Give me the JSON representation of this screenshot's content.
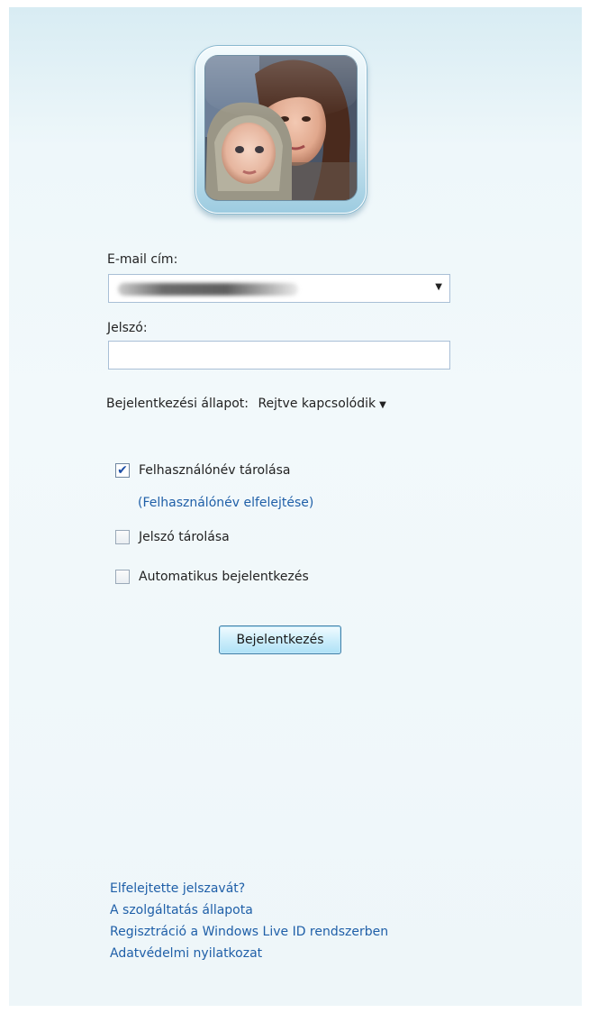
{
  "login": {
    "email_label": "E-mail cím:",
    "password_label": "Jelszó:",
    "email_value": "",
    "password_value": "",
    "status_label": "Bejelentkezési állapot:",
    "status_value": "Rejtve kapcsolódik",
    "remember_user_label": "Felhasználónév tárolása",
    "remember_user_checked": true,
    "forget_user_link": "(Felhasználónév elfelejtése)",
    "remember_password_label": "Jelszó tárolása",
    "remember_password_checked": false,
    "auto_signin_label": "Automatikus bejelentkezés",
    "auto_signin_checked": false,
    "signin_button": "Bejelentkezés"
  },
  "footer": {
    "links": [
      "Elfelejtette jelszavát?",
      "A szolgáltatás állapota",
      "Regisztráció a Windows Live ID rendszerben",
      "Adatvédelmi nyilatkozat"
    ]
  },
  "colors": {
    "link": "#1f5fa8",
    "panel_top": "#d8ecf3",
    "panel": "#f2f9fb",
    "button": "#aee1f6"
  },
  "icons": {
    "dropdown": "chevron-down-icon",
    "check": "checkmark-icon"
  }
}
